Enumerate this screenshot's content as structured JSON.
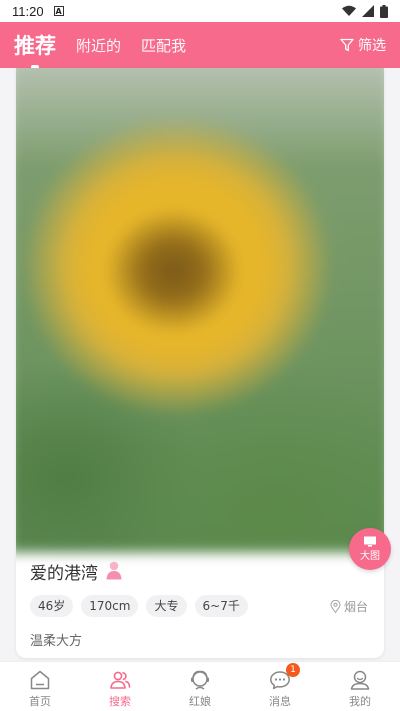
{
  "status_bar": {
    "time": "11:20",
    "notification_letter": "A"
  },
  "header": {
    "tabs": [
      {
        "label": "推荐",
        "active": true
      },
      {
        "label": "附近的",
        "active": false
      },
      {
        "label": "匹配我",
        "active": false
      }
    ],
    "filter_label": "筛选"
  },
  "profile": {
    "name": "爱的港湾",
    "tags": [
      "46岁",
      "170cm",
      "大专",
      "6~7千"
    ],
    "location": "烟台",
    "intro": "温柔大方"
  },
  "bigpic_label": "大图",
  "bottom_nav": [
    {
      "label": "首页",
      "icon": "home-icon",
      "active": false
    },
    {
      "label": "搜索",
      "icon": "users-icon",
      "active": true
    },
    {
      "label": "红娘",
      "icon": "matchmaker-icon",
      "active": false
    },
    {
      "label": "消息",
      "icon": "message-icon",
      "active": false,
      "badge": "1"
    },
    {
      "label": "我的",
      "icon": "profile-icon",
      "active": false
    }
  ],
  "colors": {
    "accent": "#f76a8c",
    "badge": "#f55a1d"
  }
}
